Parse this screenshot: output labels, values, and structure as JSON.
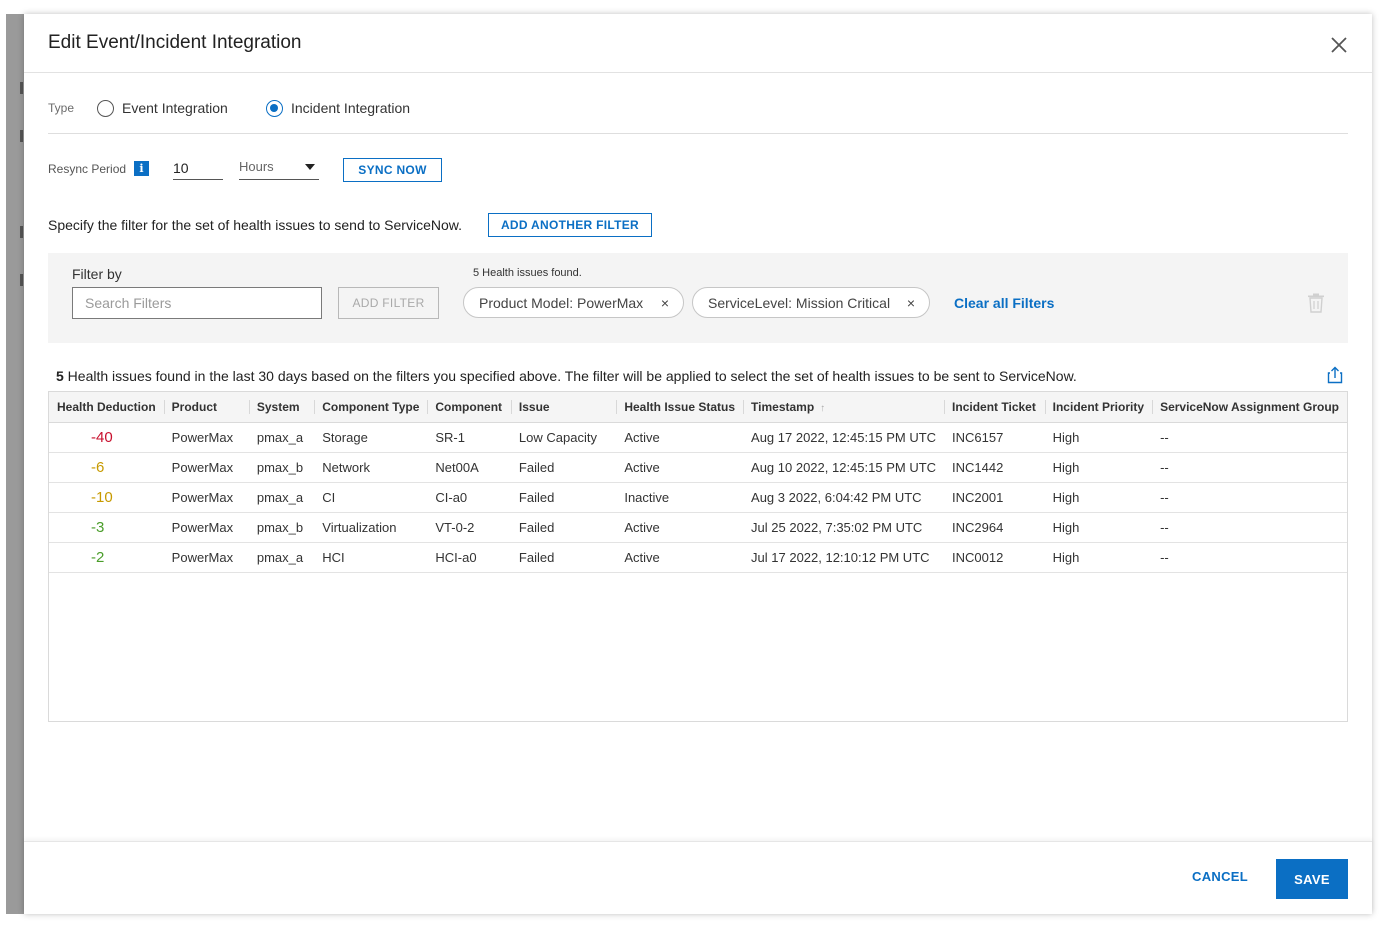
{
  "modal": {
    "title": "Edit Event/Incident Integration"
  },
  "type_row": {
    "label": "Type",
    "options": [
      {
        "label": "Event Integration",
        "selected": false
      },
      {
        "label": "Incident Integration",
        "selected": true
      }
    ]
  },
  "resync": {
    "label": "Resync Period",
    "info_icon_text": "i",
    "value": "10",
    "unit": "Hours",
    "sync_label": "SYNC NOW"
  },
  "filter_spec": {
    "text": "Specify the filter for the set of health issues to send to ServiceNow.",
    "add_another_label": "ADD ANOTHER FILTER"
  },
  "filter_panel": {
    "filter_by_label": "Filter by",
    "search_placeholder": "Search Filters",
    "add_filter_label": "ADD FILTER",
    "found_text": "5 Health issues found.",
    "chips": [
      {
        "label": "Product Model: PowerMax",
        "remove": "×"
      },
      {
        "label": "ServiceLevel: Mission Critical",
        "remove": "×"
      }
    ],
    "clear_all_label": "Clear all Filters"
  },
  "results": {
    "count": "5",
    "text": " Health issues found in the last 30 days based on the filters you specified above. The filter will be applied to select the set of health issues to be sent to ServiceNow."
  },
  "table": {
    "columns": [
      "Health Deduction",
      "Product",
      "System",
      "Component Type",
      "Component",
      "Issue",
      "Health Issue Status",
      "Timestamp",
      "Incident Ticket",
      "Incident Priority",
      "ServiceNow Assignment Group"
    ],
    "sort_indicator": "↑",
    "rows": [
      {
        "deduction": "-40",
        "color": "#c8102e",
        "product": "PowerMax",
        "system": "pmax_a",
        "component_type": "Storage",
        "component": "SR-1",
        "issue": "Low Capacity",
        "status": "Active",
        "timestamp": "Aug 17 2022, 12:45:15 PM UTC",
        "ticket": "INC6157",
        "priority": "High",
        "group": "--"
      },
      {
        "deduction": "-6",
        "color": "#c79a00",
        "product": "PowerMax",
        "system": "pmax_b",
        "component_type": "Network",
        "component": "Net00A",
        "issue": "Failed",
        "status": "Active",
        "timestamp": "Aug 10 2022, 12:45:15 PM UTC",
        "ticket": "INC1442",
        "priority": "High",
        "group": "--"
      },
      {
        "deduction": "-10",
        "color": "#c79a00",
        "product": "PowerMax",
        "system": "pmax_a",
        "component_type": "CI",
        "component": "CI-a0",
        "issue": "Failed",
        "status": "Inactive",
        "timestamp": "Aug 3 2022, 6:04:42 PM UTC",
        "ticket": "INC2001",
        "priority": "High",
        "group": "--"
      },
      {
        "deduction": "-3",
        "color": "#4a9d2a",
        "product": "PowerMax",
        "system": "pmax_b",
        "component_type": "Virtualization",
        "component": "VT-0-2",
        "issue": "Failed",
        "status": "Active",
        "timestamp": "Jul 25 2022, 7:35:02 PM UTC",
        "ticket": "INC2964",
        "priority": "High",
        "group": "--"
      },
      {
        "deduction": "-2",
        "color": "#4a9d2a",
        "product": "PowerMax",
        "system": "pmax_a",
        "component_type": "HCI",
        "component": "HCI-a0",
        "issue": "Failed",
        "status": "Active",
        "timestamp": "Jul 17 2022, 12:10:12 PM UTC",
        "ticket": "INC0012",
        "priority": "High",
        "group": "--"
      }
    ]
  },
  "footer": {
    "cancel_label": "CANCEL",
    "save_label": "SAVE"
  },
  "colors": {
    "accent": "#0b6fc4"
  }
}
